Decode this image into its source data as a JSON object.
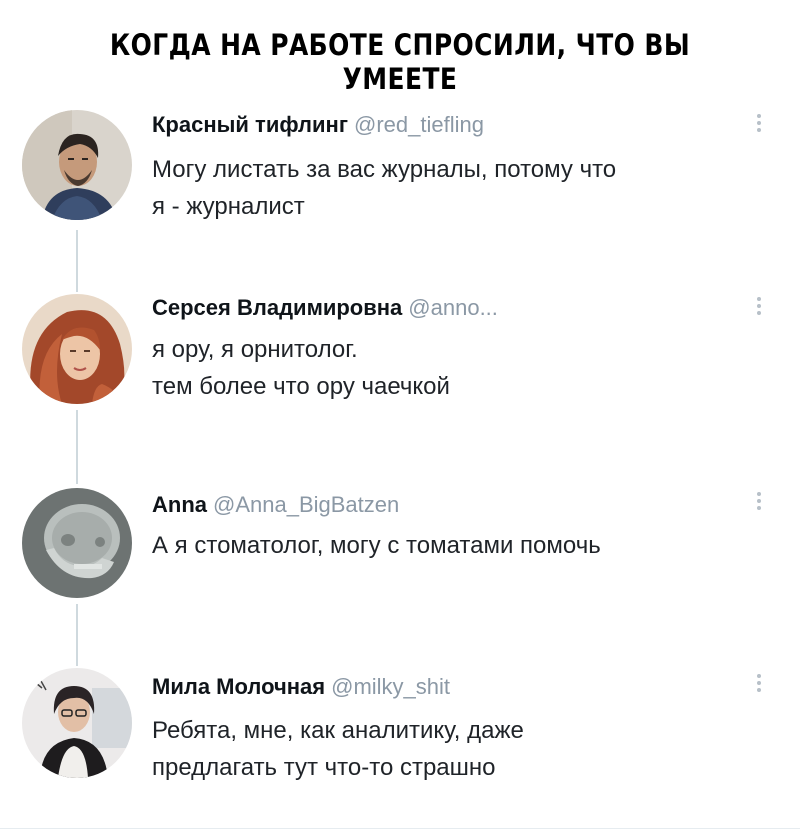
{
  "meme": {
    "title": "КОГДА НА РАБОТЕ СПРОСИЛИ, ЧТО ВЫ УМЕЕТЕ"
  },
  "tweets": [
    {
      "display_name": "Красный тифлинг",
      "handle": "@red_tiefling",
      "lines": [
        "Могу листать за вас журналы, потому что",
        "я - журналист"
      ],
      "avatar_icon": "avatar-man-icon"
    },
    {
      "display_name": "Серсея Владимировна",
      "handle": "@anno...",
      "lines": [
        "я ору, я орнитолог.",
        "тем более что ору чаечкой"
      ],
      "avatar_icon": "avatar-redhead-woman-icon"
    },
    {
      "display_name": "Anna",
      "handle": "@Anna_BigBatzen",
      "lines": [
        "А я стоматолог, могу с томатами помочь"
      ],
      "avatar_icon": "avatar-skull-xray-icon"
    },
    {
      "display_name": "Мила Молочная",
      "handle": "@milky_shit",
      "lines": [
        "Ребята, мне, как аналитику, даже",
        "предлагать тут что-то страшно"
      ],
      "avatar_icon": "avatar-woman-icon"
    }
  ],
  "colors": {
    "handle": "#8b98a5",
    "thread_line": "#cfd9de",
    "text": "#1f2328"
  }
}
